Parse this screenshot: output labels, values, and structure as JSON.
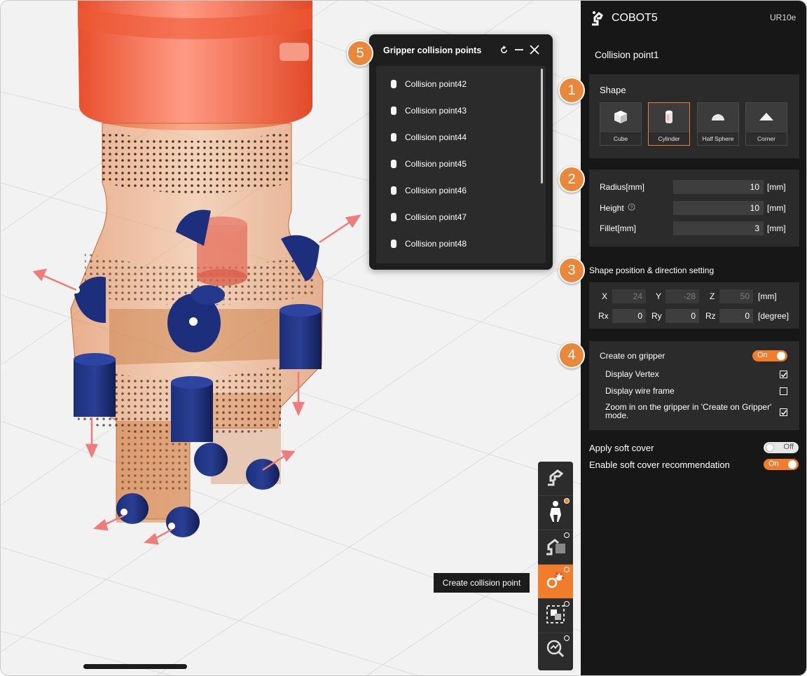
{
  "app": {
    "name": "COBOT5",
    "model": "UR10e"
  },
  "panel": {
    "collision_point_title": "Collision point1",
    "shape": {
      "label": "Shape",
      "options": [
        {
          "name": "Cube",
          "icon": "cube-icon"
        },
        {
          "name": "Cylinder",
          "icon": "cylinder-icon",
          "selected": true
        },
        {
          "name": "Half Sphere",
          "icon": "half-sphere-icon"
        },
        {
          "name": "Corner",
          "icon": "corner-icon"
        }
      ]
    },
    "dimensions": {
      "radius": {
        "label": "Radius[mm]",
        "value": "10",
        "unit": "[mm]"
      },
      "height": {
        "label": "Height",
        "value": "10",
        "unit": "[mm]",
        "help_icon": "help-circle-icon"
      },
      "fillet": {
        "label": "Fillet[mm]",
        "value": "3",
        "unit": "[mm]"
      }
    },
    "position": {
      "title": "Shape position & direction setting",
      "x": {
        "label": "X",
        "value": "24"
      },
      "y": {
        "label": "Y",
        "value": "-28"
      },
      "z": {
        "label": "Z",
        "value": "50"
      },
      "position_unit": "[mm]",
      "rx": {
        "label": "Rx",
        "value": "0"
      },
      "ry": {
        "label": "Ry",
        "value": "0"
      },
      "rz": {
        "label": "Rz",
        "value": "0"
      },
      "rotation_unit": "[degree]"
    },
    "gripper": {
      "create_on_gripper": {
        "label": "Create on gripper",
        "state": "On"
      },
      "display_vertex": {
        "label": "Display Vertex",
        "checked": true
      },
      "display_wire_frame": {
        "label": "Display wire frame",
        "checked": false
      },
      "zoom_in": {
        "label_line1": "Zoom in on the gripper in 'Create on Gripper'",
        "label_line2": "mode.",
        "checked": true
      }
    },
    "soft_cover": {
      "label": "Apply soft cover",
      "state": "Off"
    },
    "soft_cover_recommendation": {
      "label": "Enable soft cover recommendation",
      "state": "On"
    }
  },
  "popup": {
    "title": "Gripper collision points",
    "items": [
      "Collision point42",
      "Collision point43",
      "Collision point44",
      "Collision point45",
      "Collision point46",
      "Collision point47",
      "Collision point48"
    ]
  },
  "callouts": [
    "1",
    "2",
    "3",
    "4",
    "5"
  ],
  "toolbar": {
    "tooltip": "Create collision point",
    "tools": [
      "robot-arm-icon",
      "gripper-icon",
      "robot-workspace-icon",
      "collision-point-icon",
      "region-select-icon",
      "analysis-icon"
    ]
  },
  "colors": {
    "accent": "#ef7d2c",
    "panel_bg": "#171717",
    "field_bg": "#3e3e3e",
    "collision_blue": "#172a6e"
  }
}
